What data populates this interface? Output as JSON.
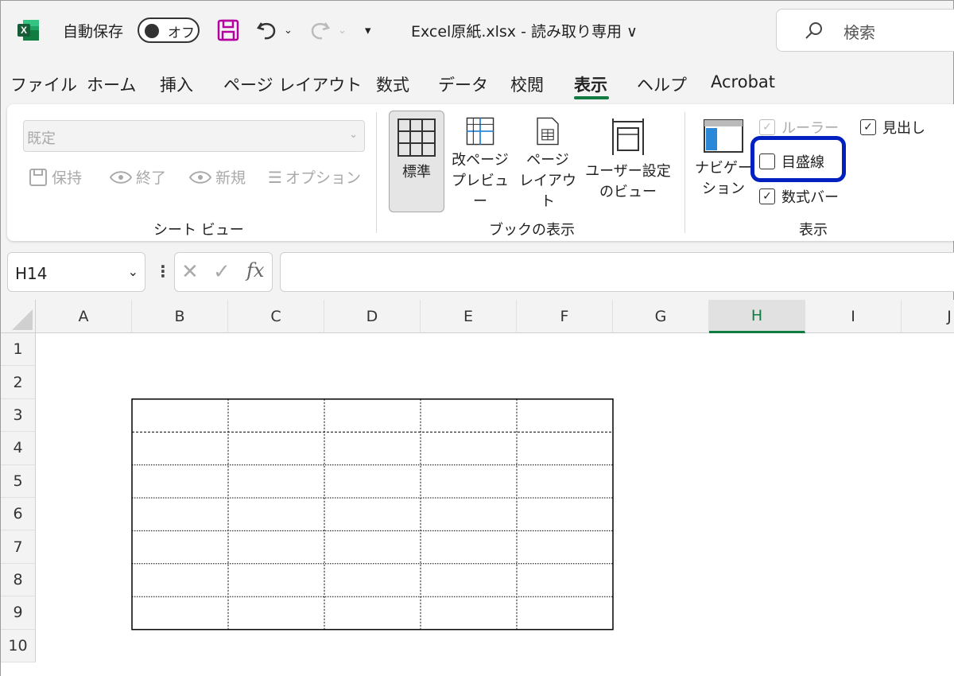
{
  "titlebar": {
    "autosave_label": "自動保存",
    "toggle_label": "オフ",
    "doc_title": "Excel原紙.xlsx  -  読み取り専用 ∨",
    "search_placeholder": "検索"
  },
  "menu": {
    "tabs": [
      "ファイル",
      "ホーム",
      "挿入",
      "ページ レイアウト",
      "数式",
      "データ",
      "校閲",
      "表示",
      "ヘルプ",
      "Acrobat"
    ],
    "active_tab": "表示"
  },
  "ribbon": {
    "sheet_view": {
      "select_value": "既定",
      "buttons": [
        "保持",
        "終了",
        "新規",
        "オプション"
      ],
      "group_label": "シート ビュー"
    },
    "workbook_view": {
      "buttons": [
        {
          "label": "標準"
        },
        {
          "label": "改ページ\nプレビュー"
        },
        {
          "label": "ページ\nレイアウト"
        },
        {
          "label": "ユーザー設定\nのビュー"
        }
      ],
      "group_label": "ブックの表示"
    },
    "show": {
      "navigation_label": "ナビゲー\nション",
      "ruler_label": "ルーラー",
      "gridlines_label": "目盛線",
      "formula_bar_label": "数式バー",
      "headings_label": "見出し",
      "group_label": "表示"
    }
  },
  "formula_bar": {
    "name_box": "H14",
    "fx": "fx",
    "formula": ""
  },
  "grid": {
    "columns": [
      "A",
      "B",
      "C",
      "D",
      "E",
      "F",
      "G",
      "H",
      "I",
      "J"
    ],
    "rows": [
      "1",
      "2",
      "3",
      "4",
      "5",
      "6",
      "7",
      "8",
      "9",
      "10"
    ],
    "active_column": "H"
  },
  "colors": {
    "accent_green": "#107c41",
    "highlight_blue": "#0020c0"
  }
}
